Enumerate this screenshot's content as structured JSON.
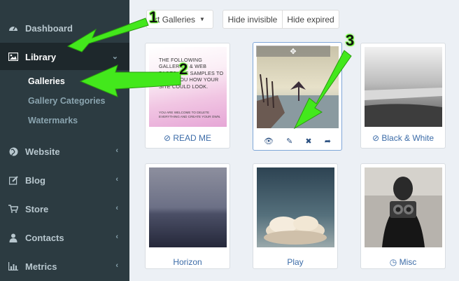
{
  "sidebar": {
    "items": [
      {
        "label": "Dashboard",
        "icon": "dashboard-icon",
        "chevron": false
      },
      {
        "label": "Library",
        "icon": "image-icon",
        "chevron": true
      },
      {
        "label": "Website",
        "icon": "globe-icon",
        "chevron": true
      },
      {
        "label": "Blog",
        "icon": "edit-icon",
        "chevron": true
      },
      {
        "label": "Store",
        "icon": "cart-icon",
        "chevron": true
      },
      {
        "label": "Contacts",
        "icon": "user-icon",
        "chevron": true
      },
      {
        "label": "Metrics",
        "icon": "bar-chart-icon",
        "chevron": true
      }
    ],
    "library_sub": [
      "Galleries",
      "Gallery Categories",
      "Watermarks"
    ]
  },
  "toolbar": {
    "sort_label": "rt Galleries",
    "hide_invisible": "Hide invisible",
    "hide_expired": "Hide expired"
  },
  "galleries": [
    {
      "caption": "READ ME",
      "status_icon": "ban-icon"
    },
    {
      "caption": "",
      "selected": true
    },
    {
      "caption": "Black & White",
      "status_icon": "ban-icon"
    },
    {
      "caption": "Horizon"
    },
    {
      "caption": "Play"
    },
    {
      "caption": "Misc",
      "status_icon": "clock-icon"
    }
  ],
  "readme": {
    "headline": "THE FOLLOWING GALLERIES & WEB PAGES ARE SAMPLES TO SHOW YOU HOW YOUR SITE COULD LOOK.",
    "note": "YOU ARE WELCOME TO DELETE EVERYTHING AND CREATE YOUR OWN."
  },
  "callouts": [
    "1",
    "2",
    "3"
  ],
  "colors": {
    "sidebar": "#2c3b41",
    "active": "#1e282c",
    "link": "#3c6ca8",
    "arrow": "#43e81c"
  }
}
